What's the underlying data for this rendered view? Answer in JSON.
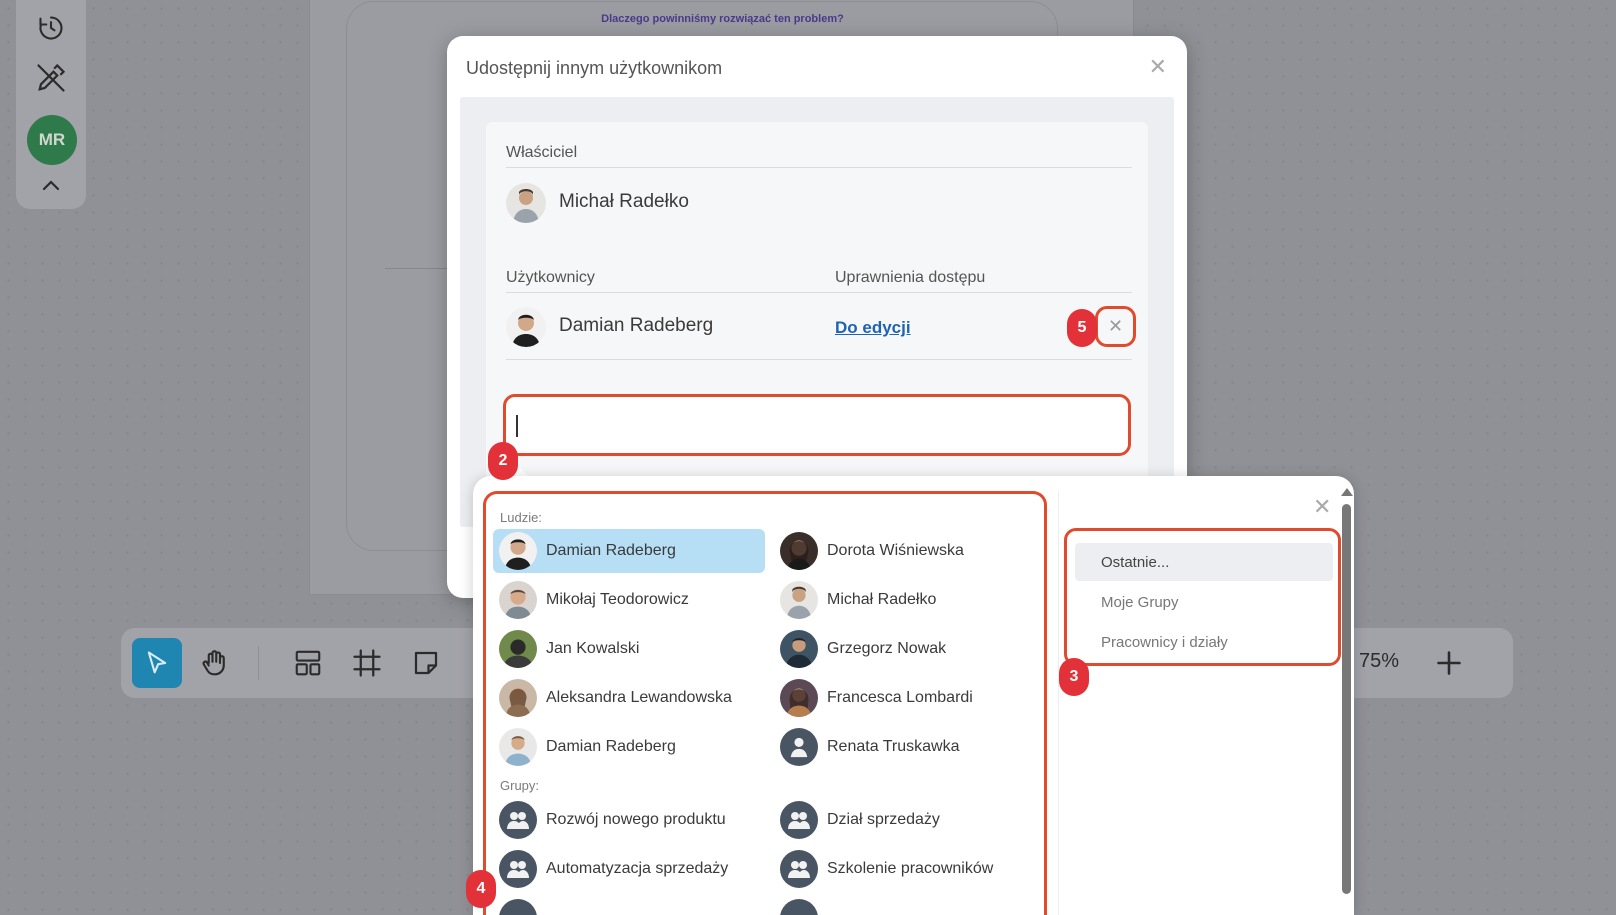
{
  "board": {
    "title": "Dlaczego powinniśmy rozwiązać ten problem?"
  },
  "left_toolbar": {
    "avatar_initials": "MR",
    "icons": [
      "history-icon",
      "pen-off-icon",
      "chevron-up-icon"
    ]
  },
  "bottom_toolbar": {
    "icons": [
      "pointer-icon",
      "hand-icon",
      "layout-icon",
      "frame-icon",
      "sticky-note-icon",
      "zoom-in-icon"
    ],
    "zoom": "75%"
  },
  "share_modal": {
    "title": "Udostępnij innym użytkownikom",
    "owner_label": "Właściciel",
    "owner_name": "Michał Radełko",
    "users_label": "Użytkownicy",
    "access_label": "Uprawnienia dostępu",
    "users": [
      {
        "name": "Damian Radeberg",
        "permission": "Do edycji"
      }
    ],
    "search_value": ""
  },
  "badges": {
    "remove": "5",
    "search": "2",
    "filters": "3",
    "results": "4"
  },
  "dropdown": {
    "people_label": "Ludzie:",
    "people": [
      {
        "name": "Damian Radeberg",
        "selected": true
      },
      {
        "name": "Dorota Wiśniewska"
      },
      {
        "name": "Mikołaj Teodorowicz"
      },
      {
        "name": "Michał Radełko"
      },
      {
        "name": "Jan Kowalski"
      },
      {
        "name": "Grzegorz Nowak"
      },
      {
        "name": "Aleksandra Lewandowska"
      },
      {
        "name": "Francesca Lombardi"
      },
      {
        "name": "Damian Radeberg"
      },
      {
        "name": "Renata Truskawka"
      }
    ],
    "groups_label": "Grupy:",
    "groups": [
      {
        "name": "Rozwój nowego produktu"
      },
      {
        "name": "Dział sprzedaży"
      },
      {
        "name": "Automatyzacja sprzedaży"
      },
      {
        "name": "Szkolenie pracowników"
      }
    ],
    "filters": [
      {
        "label": "Ostatnie...",
        "active": true
      },
      {
        "label": "Moje Grupy"
      },
      {
        "label": "Pracownicy i działy"
      }
    ]
  },
  "colors": {
    "accent": "#1f86b1",
    "highlight": "#e04b2e",
    "badge": "#e3313a",
    "selected": "#b6def4",
    "link": "#1f63b3"
  }
}
